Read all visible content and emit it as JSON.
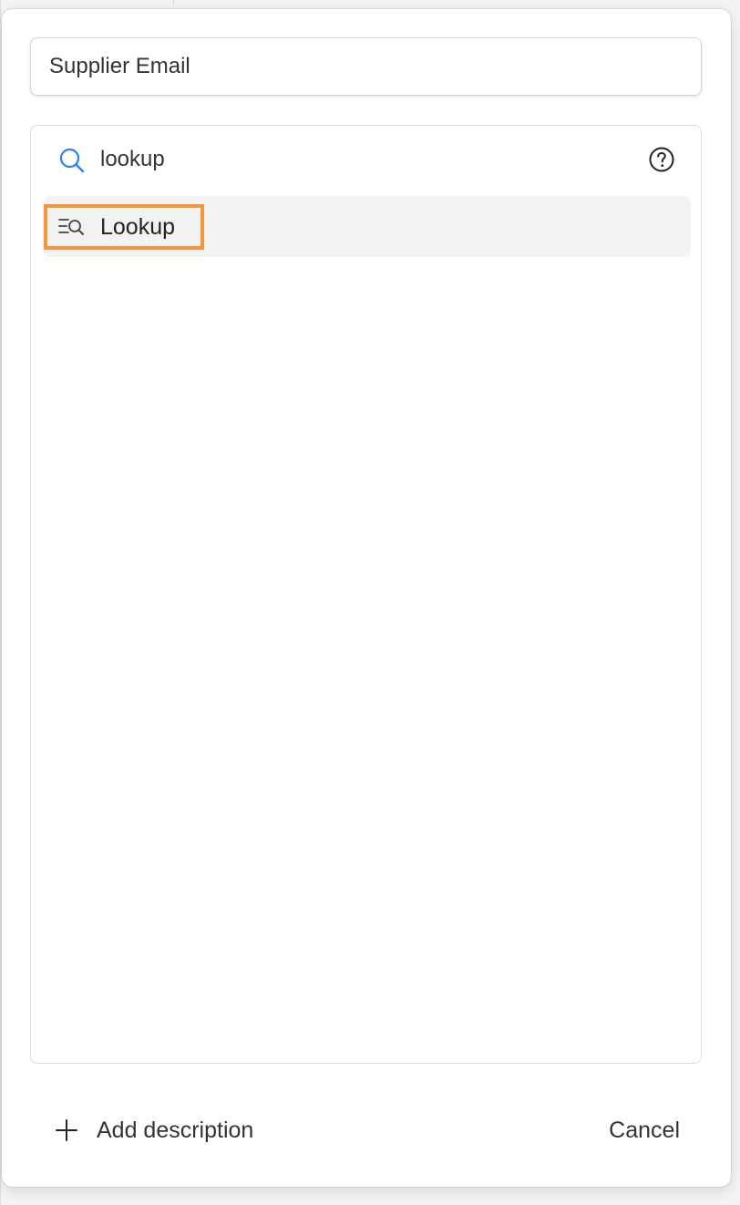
{
  "field_name": {
    "value": "Supplier Email"
  },
  "type_picker": {
    "search": {
      "value": "lookup",
      "icon": "search-icon"
    },
    "help_icon": "help-icon",
    "results": [
      {
        "label": "Lookup",
        "icon": "lookup-icon",
        "highlighted": true
      }
    ]
  },
  "footer": {
    "add_description_label": "Add description",
    "add_description_icon": "plus-icon",
    "cancel_label": "Cancel"
  },
  "colors": {
    "accent": "#2d7ff9",
    "highlight_border": "#f0983a",
    "result_bg": "#f2f2f2"
  }
}
